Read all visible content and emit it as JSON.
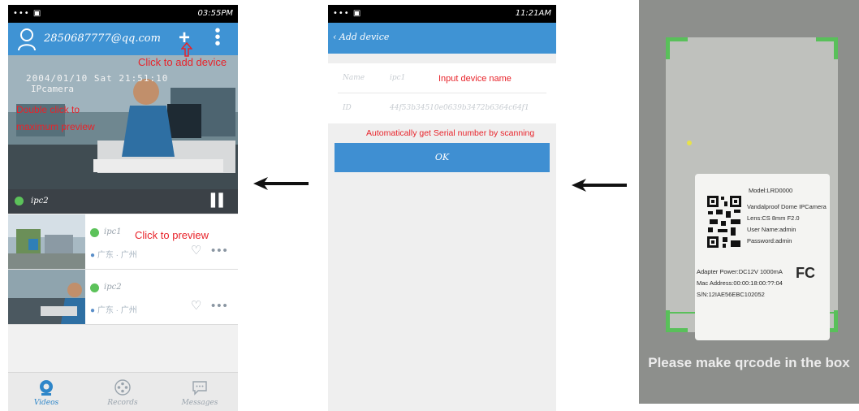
{
  "phone1": {
    "status": {
      "left": "••• ▣",
      "right": "03:55PM"
    },
    "header": {
      "email": "2850687777@qq.com"
    },
    "video": {
      "osd_datetime": "2004/01/10 Sat 21:51:10",
      "osd_camera": "IPcamera"
    },
    "control_bar": {
      "device_name": "ipc2"
    },
    "devices": [
      {
        "name": "ipc1",
        "location": "广东 · 广州"
      },
      {
        "name": "ipc2",
        "location": "广东 · 广州"
      }
    ],
    "tabs": [
      {
        "label": "Videos"
      },
      {
        "label": "Records"
      },
      {
        "label": "Messages"
      }
    ]
  },
  "phone2": {
    "status": {
      "left": "••• ▣",
      "right": "11:21AM"
    },
    "header": {
      "back_label": "‹ Add device"
    },
    "form": {
      "name_label": "Name",
      "name_value": "ipc1",
      "id_label": "ID",
      "id_value": "44f53b34510e0639b3472b6364c64f1"
    },
    "ok_label": "OK"
  },
  "phone3": {
    "caption": "Please make qrcode in the box",
    "label_lines": [
      "Model:LRD0000",
      "Vandalproof Dome IPCamera",
      "Lens:CS 8mm F2.0",
      "User Name:admin",
      "Password:admin",
      "Adapter Power:DC12V 1000mA",
      "Mac Address:00:00:18:00:??:04",
      "S/N:12IAE56EBC102052"
    ],
    "cert_mark": "FC"
  },
  "annotations": {
    "add_device": "Click to add device",
    "double_click": "Double click to",
    "maximum_preview": "maximum preview",
    "click_preview": "Click to preview",
    "input_name": "Input device name",
    "auto_serial": "Automatically get Serial number by scanning"
  },
  "colors": {
    "header_blue": "#3f93d4",
    "annotation_red": "#e8232a",
    "online_green": "#5cc25a",
    "scan_green": "#59c05a"
  }
}
